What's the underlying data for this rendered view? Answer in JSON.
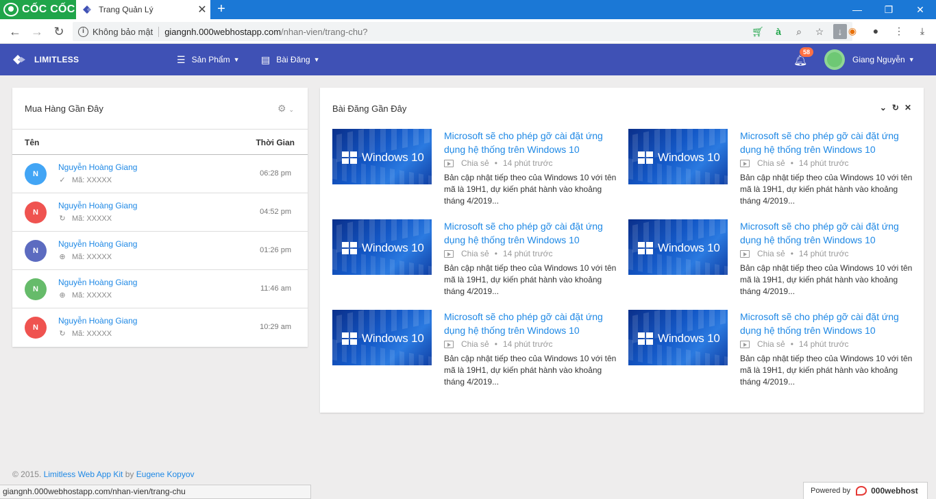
{
  "browser": {
    "brand": "CỐC CỐC",
    "tab_title": "Trang Quản Lý",
    "new_tab": "+",
    "security_label": "Không bảo mật",
    "url_host": "giangnh.000webhostapp.com",
    "url_path": "/nhan-vien/trang-chu?",
    "status_url": "giangnh.000webhostapp.com/nhan-vien/trang-chu"
  },
  "navbar": {
    "brand": "LIMITLESS",
    "menu": [
      {
        "label": "Sản Phẩm",
        "icon": "menu-icon"
      },
      {
        "label": "Bài Đăng",
        "icon": "newspaper-icon"
      }
    ],
    "notification_count": "58",
    "user_name": "Giang Nguyễn"
  },
  "orders": {
    "title": "Mua Hàng Gần Đây",
    "col_name": "Tên",
    "col_time": "Thời Gian",
    "rows": [
      {
        "initial": "N",
        "name": "Nguyễn Hoàng Giang",
        "status_icon": "check-icon",
        "code": "Mã: XXXXX",
        "time": "06:28 pm",
        "color": "#42a5f5"
      },
      {
        "initial": "N",
        "name": "Nguyễn Hoàng Giang",
        "status_icon": "refresh-icon",
        "code": "Mã: XXXXX",
        "time": "04:52 pm",
        "color": "#ef5350"
      },
      {
        "initial": "N",
        "name": "Nguyễn Hoàng Giang",
        "status_icon": "globe-icon",
        "code": "Mã: XXXXX",
        "time": "01:26 pm",
        "color": "#5c6bc0"
      },
      {
        "initial": "N",
        "name": "Nguyễn Hoàng Giang",
        "status_icon": "globe-icon",
        "code": "Mã: XXXXX",
        "time": "11:46 am",
        "color": "#66bb6a"
      },
      {
        "initial": "N",
        "name": "Nguyễn Hoàng Giang",
        "status_icon": "refresh-icon",
        "code": "Mã: XXXXX",
        "time": "10:29 am",
        "color": "#ef5350"
      }
    ]
  },
  "posts": {
    "title": "Bài Đăng Gần Đây",
    "items": [
      {
        "thumb_text": "Windows 10",
        "title": "Microsoft sẽ cho phép gỡ cài đặt ứng dụng hệ thống trên Windows 10",
        "share": "Chia sẻ",
        "dot": "•",
        "ago": "14 phút trước",
        "desc": "Bản cập nhật tiếp theo của Windows 10 với tên mã là 19H1, dự kiến phát hành vào khoảng tháng 4/2019..."
      },
      {
        "thumb_text": "Windows 10",
        "title": "Microsoft sẽ cho phép gỡ cài đặt ứng dụng hệ thống trên Windows 10",
        "share": "Chia sẻ",
        "dot": "•",
        "ago": "14 phút trước",
        "desc": "Bản cập nhật tiếp theo của Windows 10 với tên mã là 19H1, dự kiến phát hành vào khoảng tháng 4/2019..."
      },
      {
        "thumb_text": "Windows 10",
        "title": "Microsoft sẽ cho phép gỡ cài đặt ứng dụng hệ thống trên Windows 10",
        "share": "Chia sẻ",
        "dot": "•",
        "ago": "14 phút trước",
        "desc": "Bản cập nhật tiếp theo của Windows 10 với tên mã là 19H1, dự kiến phát hành vào khoảng tháng 4/2019..."
      },
      {
        "thumb_text": "Windows 10",
        "title": "Microsoft sẽ cho phép gỡ cài đặt ứng dụng hệ thống trên Windows 10",
        "share": "Chia sẻ",
        "dot": "•",
        "ago": "14 phút trước",
        "desc": "Bản cập nhật tiếp theo của Windows 10 với tên mã là 19H1, dự kiến phát hành vào khoảng tháng 4/2019..."
      },
      {
        "thumb_text": "Windows 10",
        "title": "Microsoft sẽ cho phép gỡ cài đặt ứng dụng hệ thống trên Windows 10",
        "share": "Chia sẻ",
        "dot": "•",
        "ago": "14 phút trước",
        "desc": "Bản cập nhật tiếp theo của Windows 10 với tên mã là 19H1, dự kiến phát hành vào khoảng tháng 4/2019..."
      },
      {
        "thumb_text": "Windows 10",
        "title": "Microsoft sẽ cho phép gỡ cài đặt ứng dụng hệ thống trên Windows 10",
        "share": "Chia sẻ",
        "dot": "•",
        "ago": "14 phút trước",
        "desc": "Bản cập nhật tiếp theo của Windows 10 với tên mã là 19H1, dự kiến phát hành vào khoảng tháng 4/2019..."
      }
    ]
  },
  "footer": {
    "copyright": "© 2015.",
    "kit_link": "Limitless Web App Kit",
    "by": "by",
    "author_link": "Eugene Kopyov"
  },
  "powered": {
    "label": "Powered by",
    "host": "000webhost"
  },
  "colors": {
    "navbar": "#3f51b5",
    "tabbar": "#1b78d6",
    "link": "#1e88e5",
    "badge": "#ff7043"
  }
}
